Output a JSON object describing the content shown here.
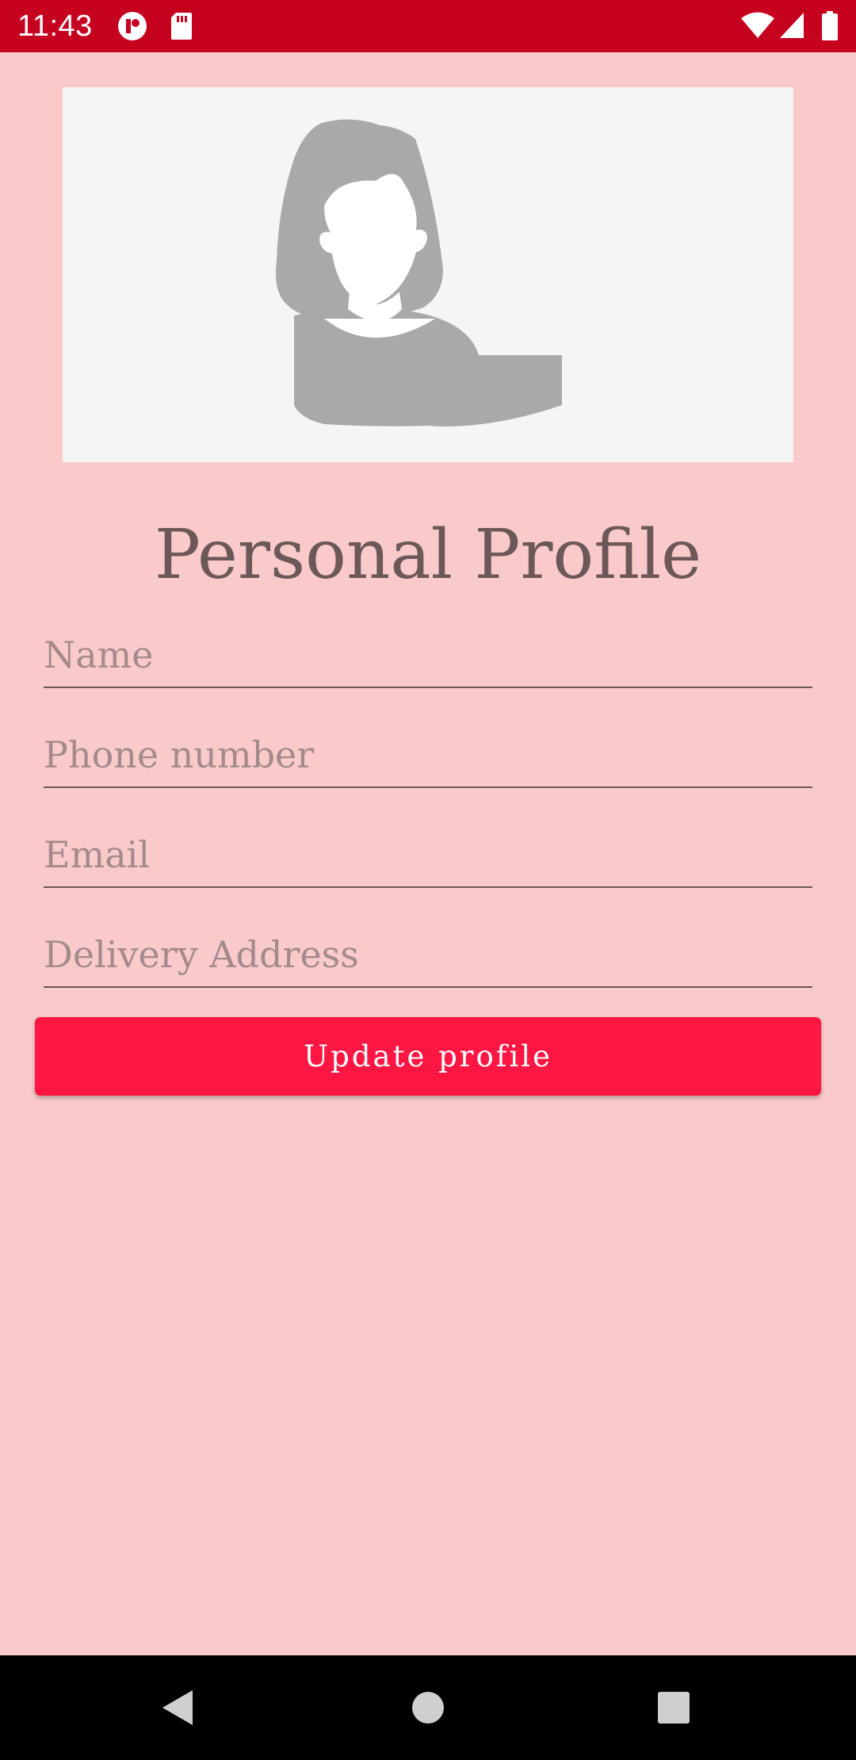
{
  "status_bar": {
    "time": "11:43",
    "icons": [
      "app-notification-icon",
      "sd-card-icon",
      "wifi-icon",
      "cellular-signal-icon",
      "battery-icon"
    ],
    "background": "#c6001f"
  },
  "profile": {
    "avatar": "female-avatar-placeholder",
    "title": "Personal Profile"
  },
  "form": {
    "name_placeholder": "Name",
    "name_value": "",
    "phone_placeholder": "Phone number",
    "phone_value": "",
    "email_placeholder": "Email",
    "email_value": "",
    "address_placeholder": "Delivery Address",
    "address_value": "",
    "submit_label": "Update profile"
  },
  "nav_bar": {
    "buttons": [
      "back-icon",
      "home-icon",
      "recents-icon"
    ]
  },
  "colors": {
    "background": "#facacb",
    "accent": "#ff1744",
    "text": "#6c5858",
    "placeholder": "#a48a8b"
  }
}
